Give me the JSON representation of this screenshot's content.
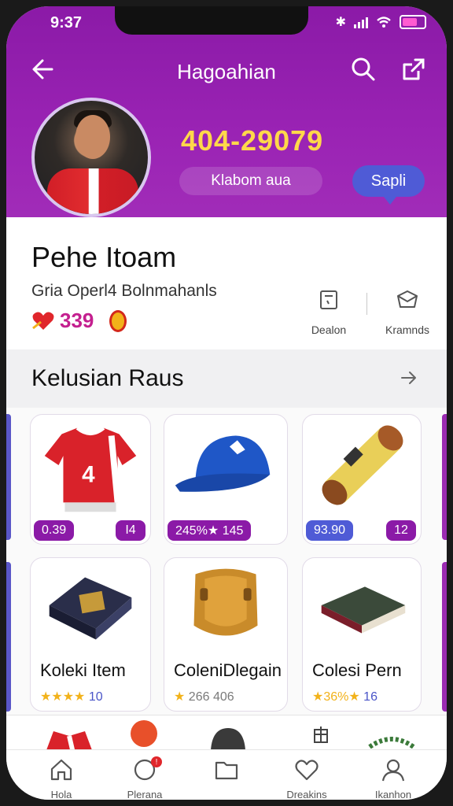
{
  "status": {
    "time": "9:37"
  },
  "header": {
    "title": "Hagoahian",
    "score": "404-29079",
    "name_pill": "Klabom aua",
    "sapi_label": "Sapli"
  },
  "profile": {
    "name": "Pehe Itoam",
    "subtitle": "Gria Operl4 Bolnmahanls",
    "stat_value": "339",
    "action_left": "Dealon",
    "action_right": "Kramnds"
  },
  "section": {
    "title": "Kelusian Raus"
  },
  "products_top": [
    {
      "price": "0.39",
      "qty": "I4"
    },
    {
      "price": "245%★ 145",
      "qty": ""
    },
    {
      "price": "93.90",
      "qty": "12"
    }
  ],
  "products_bottom": [
    {
      "title": "Koleki Item",
      "stars": "★★★★",
      "rating": "10"
    },
    {
      "title": "ColeniDlegain",
      "stars": "★",
      "rating": "266 406"
    },
    {
      "title": "Colesi Pern",
      "stars": "★36%★",
      "rating": "16"
    }
  ],
  "tabs": [
    {
      "label": "Hola"
    },
    {
      "label": "Plerana"
    },
    {
      "label": ""
    },
    {
      "label": "Dreakins"
    },
    {
      "label": "Ikanhon"
    }
  ],
  "colors": {
    "header": "#8b1aa7",
    "accent": "#4f5bd6",
    "score": "#ffd84a"
  }
}
